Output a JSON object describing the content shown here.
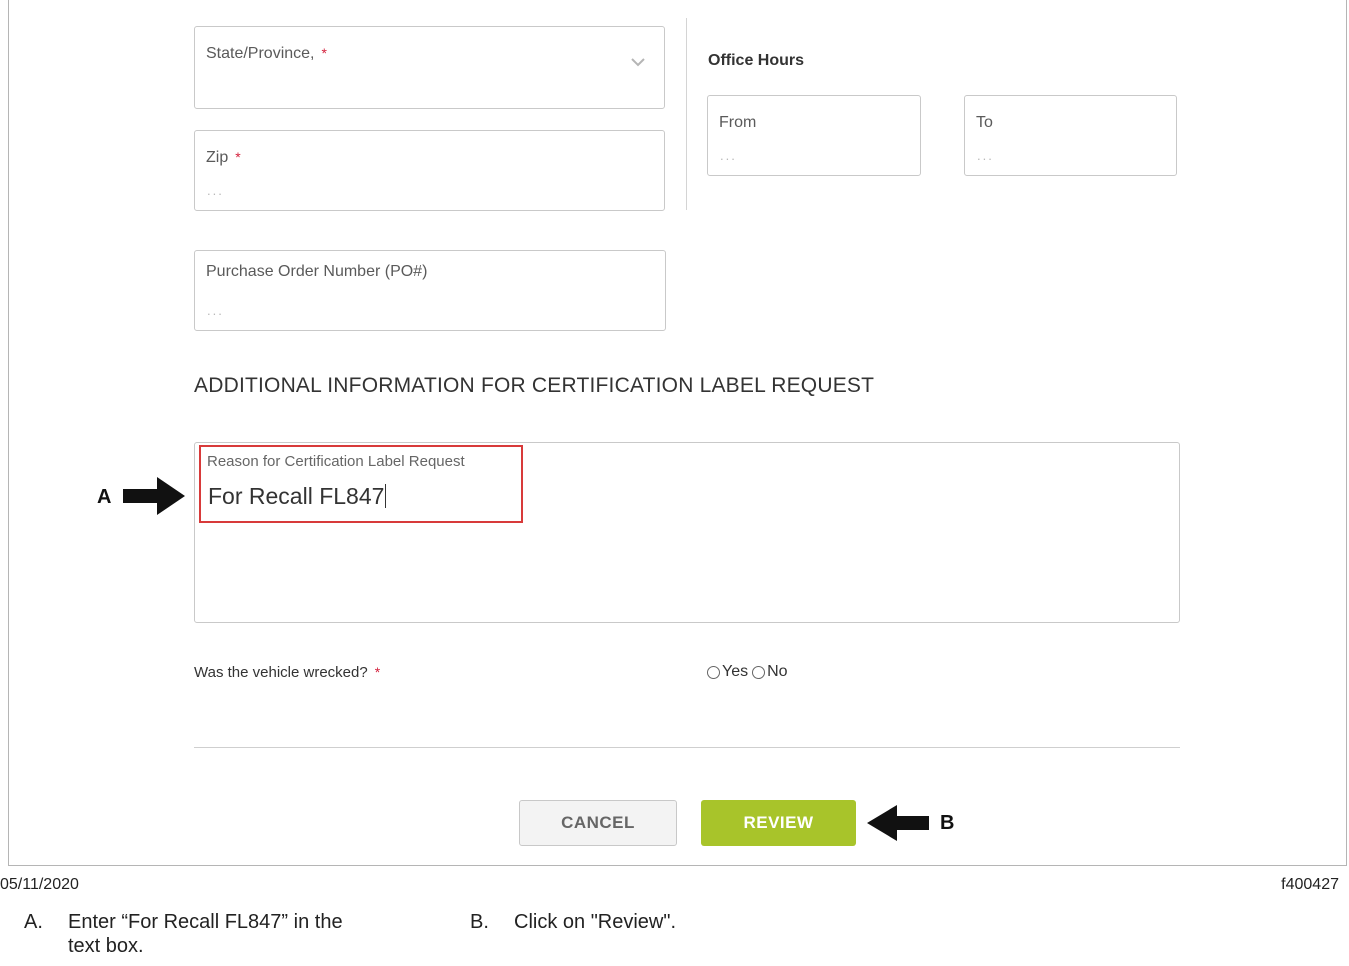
{
  "form": {
    "state": {
      "label": "State/Province,",
      "required_mark": "*"
    },
    "zip": {
      "label": "Zip",
      "required_mark": "*",
      "placeholder": "..."
    },
    "po": {
      "label": "Purchase Order Number (PO#)",
      "placeholder": "..."
    },
    "office_hours": {
      "title": "Office Hours",
      "from": {
        "label": "From",
        "placeholder": "..."
      },
      "to": {
        "label": "To",
        "placeholder": "..."
      }
    },
    "section_title": "ADDITIONAL INFORMATION FOR CERTIFICATION LABEL REQUEST",
    "reason": {
      "label": "Reason for Certification Label Request",
      "value": "For Recall FL847"
    },
    "wrecked": {
      "question": "Was the vehicle wrecked?",
      "required_mark": "*",
      "yes": "Yes",
      "no": "No"
    },
    "buttons": {
      "cancel": "CANCEL",
      "review": "REVIEW"
    }
  },
  "callouts": {
    "a": "A",
    "b": "B"
  },
  "footer": {
    "date": "05/11/2020",
    "figure_id": "f400427"
  },
  "notes": {
    "a_letter": "A.",
    "a_text_line1": "Enter “For Recall FL847” in the",
    "a_text_line2": "text box.",
    "b_letter": "B.",
    "b_text": "Click on \"Review\"."
  },
  "colors": {
    "required": "#d4213d",
    "review_button": "#a8c42a",
    "highlight": "#d83a3a"
  }
}
